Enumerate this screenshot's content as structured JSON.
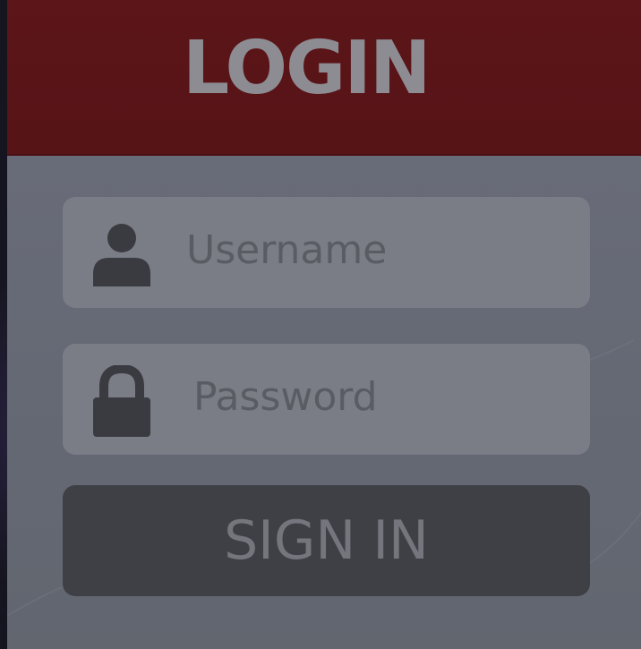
{
  "login_panel": {
    "title": "LOGIN",
    "username": {
      "placeholder": "Username",
      "icon": "user-icon"
    },
    "password": {
      "placeholder": "Password",
      "icon": "lock-icon"
    },
    "sign_in_label": "SIGN IN"
  },
  "colors": {
    "header": "#5c1518",
    "panel": "#686b77",
    "field": "#7a7c86",
    "button": "#3f4046",
    "icon": "#3a3b40"
  }
}
